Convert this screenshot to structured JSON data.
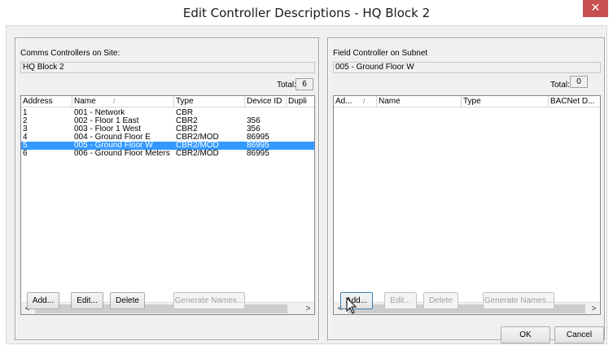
{
  "window": {
    "title": "Edit Controller Descriptions - HQ Block 2",
    "close_glyph": "✕"
  },
  "left_panel": {
    "label": "Comms Controllers on Site:",
    "site_value": "HQ Block 2",
    "total_label": "Total:",
    "total_value": "6",
    "columns": [
      "Address",
      "Name",
      "Type",
      "Device ID",
      "Dupli"
    ],
    "name_sort_glyph": "/",
    "rows": [
      {
        "address": "1",
        "name": "001 - Network",
        "type": "CBR",
        "device_id": ""
      },
      {
        "address": "2",
        "name": "002 - Floor 1 East",
        "type": "CBR2",
        "device_id": "356"
      },
      {
        "address": "3",
        "name": "003 - Floor 1 West",
        "type": "CBR2",
        "device_id": "356"
      },
      {
        "address": "4",
        "name": "004 - Ground Floor E",
        "type": "CBR2/MOD",
        "device_id": "86995"
      },
      {
        "address": "5",
        "name": "005 - Ground Floor W",
        "type": "CBR2/MOD",
        "device_id": "86995"
      },
      {
        "address": "6",
        "name": "006 - Ground Floor Meters",
        "type": "CBR2/MOD",
        "device_id": "86995"
      }
    ],
    "selected_row": 4,
    "buttons": {
      "add": "Add...",
      "edit": "Edit...",
      "delete": "Delete",
      "generate": "Generate Names..."
    }
  },
  "right_panel": {
    "label": "Field Controller on Subnet",
    "subnet_value": "005 - Ground Floor W",
    "total_label": "Total:",
    "total_value": "0",
    "columns": [
      "Ad...",
      "Name",
      "Type",
      "BACNet D..."
    ],
    "name_sort_glyph": "/",
    "rows": [],
    "buttons": {
      "add": "Add...",
      "edit": "Edit...",
      "delete": "Delete",
      "generate": "Generate Names..."
    }
  },
  "footer": {
    "ok": "OK",
    "cancel": "Cancel"
  },
  "scroll": {
    "left_arrow": "<",
    "right_arrow": ">"
  },
  "icons": {
    "close": "close-icon",
    "cursor": "mouse-pointer-icon"
  }
}
